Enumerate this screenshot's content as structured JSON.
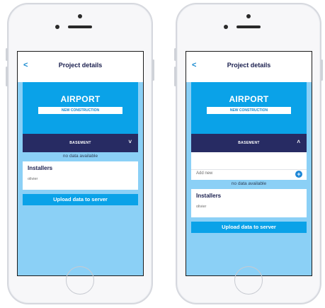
{
  "left_screen": {
    "back_symbol": "<",
    "title": "Project details",
    "project_name": "AIRPORT",
    "project_tag": "NEW CONSTRUCTION",
    "section_label": "BASEMENT",
    "section_chevron": "˅",
    "no_data": "no data available",
    "installers_heading": "Installers",
    "installer_name": "olivier",
    "upload_label": "Upload data to server"
  },
  "right_screen": {
    "back_symbol": "<",
    "title": "Project details",
    "project_name": "AIRPORT",
    "project_tag": "NEW CONSTRUCTION",
    "section_label": "BASEMENT",
    "section_chevron": "˄",
    "add_new_label": "Add new",
    "add_icon": "+",
    "no_data": "no data available",
    "installers_heading": "Installers",
    "installer_name": "olivier",
    "upload_label": "Upload data to server"
  },
  "colors": {
    "screen_bg": "#8bd0f6",
    "accent_blue": "#0aa2e8",
    "navy": "#272b63",
    "title_navy": "#1a1f4e"
  }
}
